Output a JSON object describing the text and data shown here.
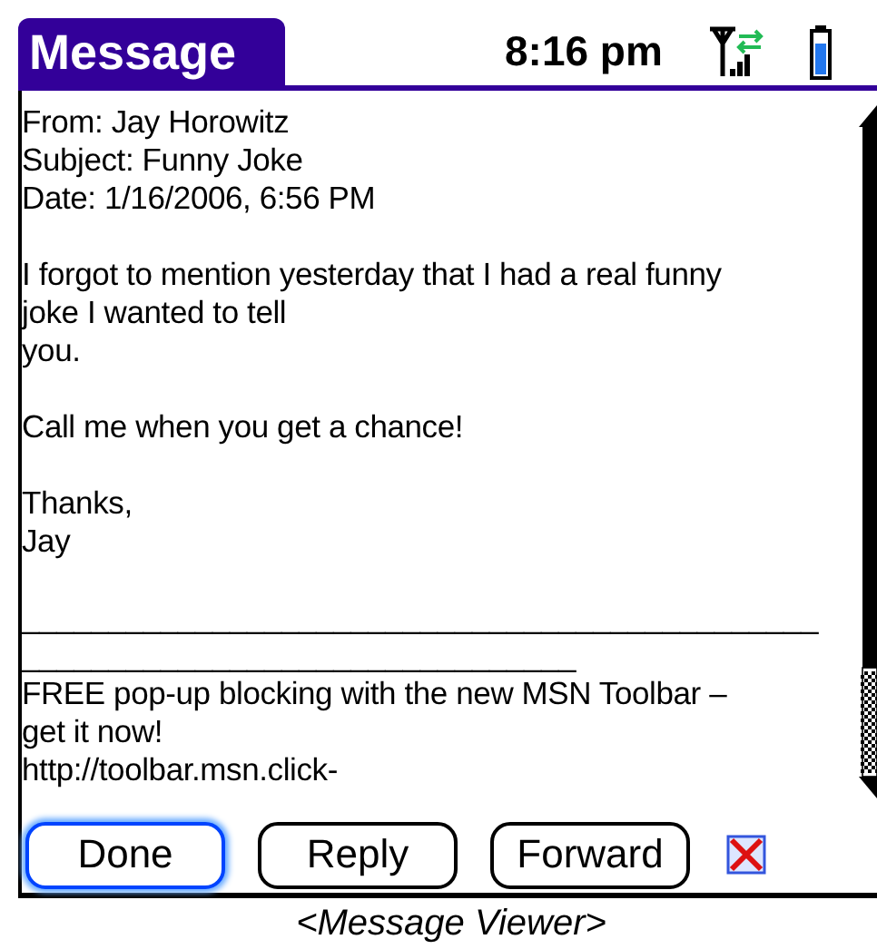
{
  "title": "Message",
  "time": "8:16 pm",
  "message": {
    "paragraphs": [
      {
        "lines": [
          "From: Jay Horowitz",
          "Subject: Funny Joke",
          "Date: 1/16/2006, 6:56 PM"
        ]
      },
      {
        "lines": [
          "I forgot to mention yesterday that I had a real funny",
          "joke I wanted to tell",
          "you."
        ]
      },
      {
        "lines": [
          "Call me when you get a chance!"
        ]
      },
      {
        "lines": [
          "Thanks,",
          "Jay"
        ]
      },
      {
        "lines": [
          "______________________________________________",
          "________________________________",
          "FREE pop-up blocking with the new MSN Toolbar –",
          "get it now!",
          "http://toolbar.msn.click-"
        ]
      }
    ]
  },
  "buttons": [
    {
      "label": "Done",
      "selected": true
    },
    {
      "label": "Reply",
      "selected": false
    },
    {
      "label": "Forward",
      "selected": false
    }
  ],
  "caption": "<Message Viewer>"
}
